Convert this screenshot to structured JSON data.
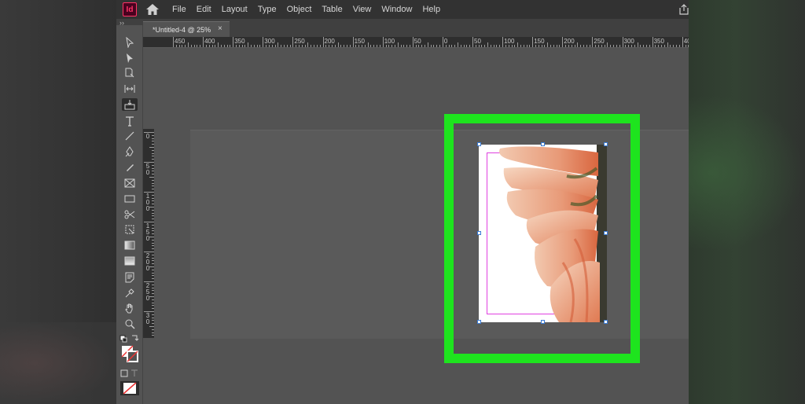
{
  "app": {
    "logo_text": "Id"
  },
  "menu": {
    "items": [
      "File",
      "Edit",
      "Layout",
      "Type",
      "Object",
      "Table",
      "View",
      "Window",
      "Help"
    ]
  },
  "panel": {
    "collapse_label": "››"
  },
  "tab": {
    "title": "*Untitled-4 @ 25%",
    "close_label": "×"
  },
  "ruler": {
    "top_labels": [
      "450",
      "400",
      "350",
      "300",
      "250",
      "200",
      "150",
      "100",
      "50",
      "0",
      "50",
      "100",
      "150",
      "200",
      "250",
      "300",
      "350",
      "40"
    ],
    "left_labels": [
      "0",
      "5\n0",
      "1\n0\n0",
      "1\n5\n0",
      "2\n0\n0",
      "2\n5\n0",
      "3\n0"
    ]
  },
  "tools": [
    "selection-tool-icon",
    "direct-selection-tool-icon",
    "page-tool-icon",
    "gap-tool-icon",
    "content-collector-tool-icon",
    "type-tool-icon",
    "line-tool-icon",
    "pen-tool-icon",
    "pencil-tool-icon",
    "rectangle-frame-tool-icon",
    "rectangle-tool-icon",
    "scissors-tool-icon",
    "free-transform-tool-icon",
    "gradient-swatch-tool-icon",
    "gradient-feather-tool-icon",
    "note-tool-icon",
    "eyedropper-tool-icon",
    "hand-tool-icon",
    "zoom-tool-icon"
  ],
  "colors": {
    "highlight": "#1ee41e",
    "margin_guide": "#e040e0",
    "selection": "#3a7bd5"
  }
}
